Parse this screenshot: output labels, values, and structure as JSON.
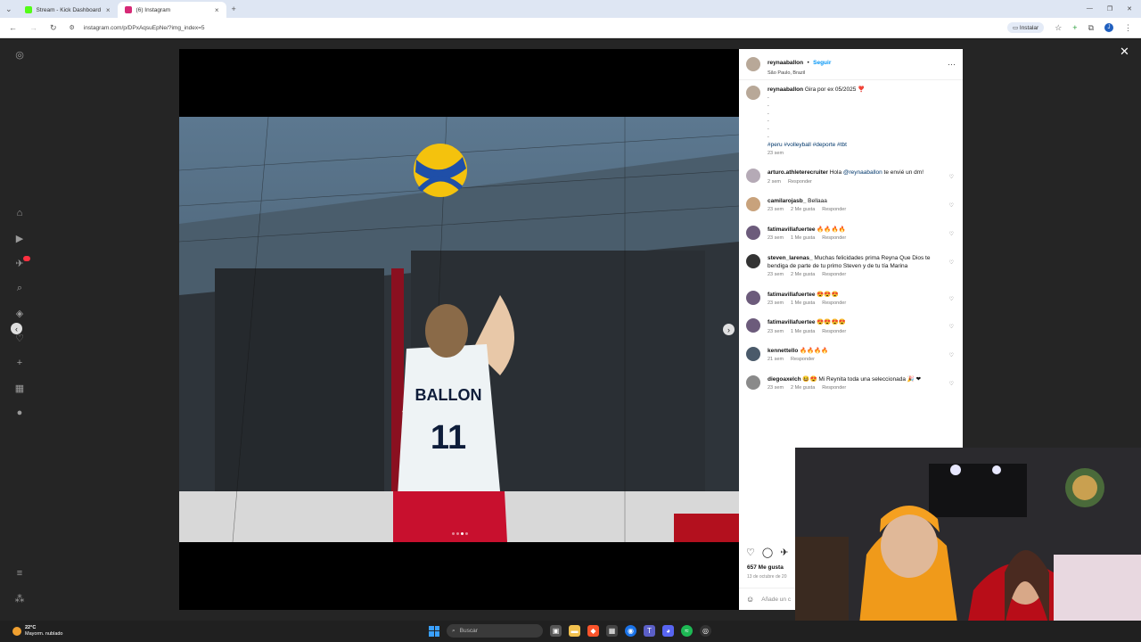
{
  "browser": {
    "tabs": [
      {
        "label": "Stream - Kick Dashboard",
        "active": false,
        "color": "#53fc18"
      },
      {
        "label": "(6) Instagram",
        "active": true,
        "color": "#d62976"
      }
    ],
    "url": "instagram.com/p/DPxAqsuEpNe/?img_index=5",
    "install_label": "Instalar",
    "profile_initial": "J"
  },
  "post": {
    "username": "reynaaballon",
    "follow_label": "Seguir",
    "location": "São Paulo, Brazil",
    "caption_text": "Gira por ex 05/2025 ❣️",
    "caption_dots": [
      ".",
      ".",
      ".",
      ".",
      ".",
      "."
    ],
    "hashtags": "#peru #volleyball #deporte #tbt",
    "caption_time": "23 sem",
    "jersey_name": "BALLON",
    "jersey_number": "11",
    "likes": "657 Me gusta",
    "date": "13 de octubre de 20",
    "add_comment_placeholder": "Añade un c"
  },
  "comments": [
    {
      "user": "arturo.athleterecruiter",
      "pre": "Hola ",
      "mention": "@reynaaballon",
      "post": " te envié un dm!",
      "time": "2 sem",
      "likes": "",
      "reply": "Responder",
      "avatar": "#b5aab6"
    },
    {
      "user": "camilarojasb_",
      "pre": "Bellaaa",
      "mention": "",
      "post": "",
      "time": "23 sem",
      "likes": "2 Me gusta",
      "reply": "Responder",
      "avatar": "#c8a27c"
    },
    {
      "user": "fatimavillafuertee",
      "pre": "🔥🔥🔥🔥",
      "mention": "",
      "post": "",
      "time": "23 sem",
      "likes": "1 Me gusta",
      "reply": "Responder",
      "avatar": "#6c5b7b"
    },
    {
      "user": "steven_larenas_",
      "pre": "Muchas felicidades prima Reyna Que Dios te bendiga de parte de tu primo Steven y de tu tía Marina",
      "mention": "",
      "post": "",
      "time": "23 sem",
      "likes": "2 Me gusta",
      "reply": "Responder",
      "avatar": "#333333"
    },
    {
      "user": "fatimavillafuertee",
      "pre": "😍😍😍",
      "mention": "",
      "post": "",
      "time": "23 sem",
      "likes": "1 Me gusta",
      "reply": "Responder",
      "avatar": "#6c5b7b"
    },
    {
      "user": "fatimavillafuertee",
      "pre": "😍😍😍😍",
      "mention": "",
      "post": "",
      "time": "23 sem",
      "likes": "1 Me gusta",
      "reply": "Responder",
      "avatar": "#6c5b7b"
    },
    {
      "user": "kennettello",
      "pre": "🔥🔥🔥🔥",
      "mention": "",
      "post": "",
      "time": "21 sem",
      "likes": "",
      "reply": "Responder",
      "avatar": "#4a5a6a"
    },
    {
      "user": "diegoaxelch",
      "pre": "😆😍 Mi Reynita toda una seleccionada 🎉 ❤",
      "mention": "",
      "post": "",
      "time": "23 sem",
      "likes": "2 Me gusta",
      "reply": "Responder",
      "avatar": "#8a8a8a"
    }
  ],
  "taskbar": {
    "temperature": "22°C",
    "weather": "Mayorm. nublado",
    "search_placeholder": "Buscar"
  },
  "colors": {
    "instagram_link": "#0095f6",
    "notification": "#ff3040",
    "jersey_red": "#c8102e"
  }
}
